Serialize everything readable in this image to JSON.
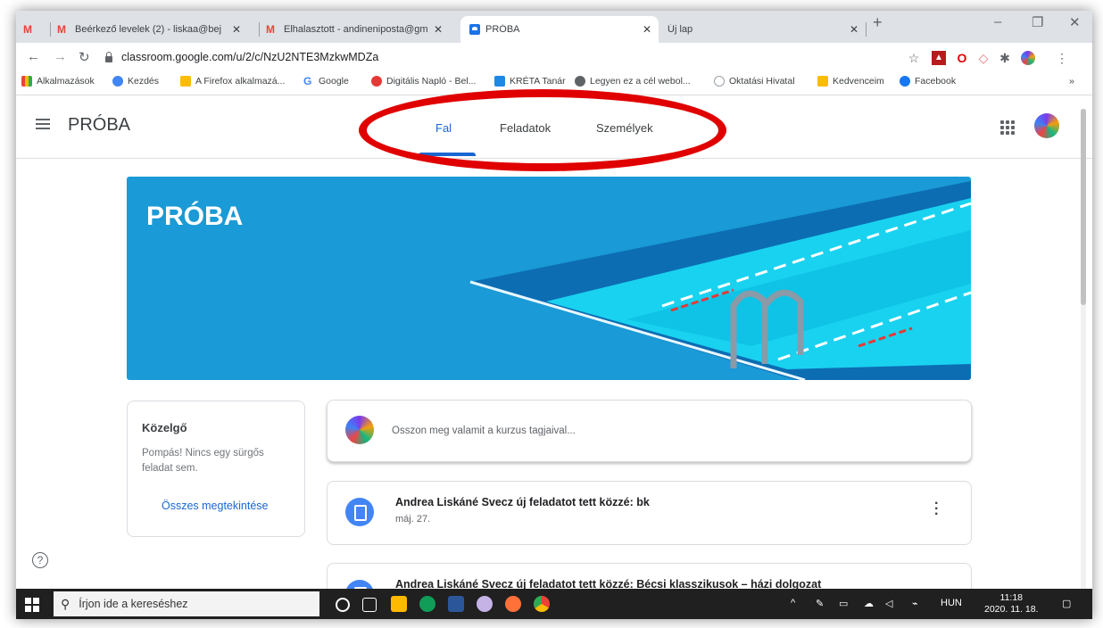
{
  "browser": {
    "tabs": [
      {
        "icon": "gmail-icon",
        "title": ""
      },
      {
        "icon": "gmail-icon",
        "title": "Beérkező levelek (2) - liskaa@bej"
      },
      {
        "icon": "gmail-icon",
        "title": "Elhalasztott - andineniposta@gm"
      },
      {
        "icon": "classroom-icon",
        "title": "PRÓBA"
      },
      {
        "icon": "",
        "title": "Új lap"
      }
    ],
    "tab_close": "✕",
    "new_tab": "+",
    "url": "classroom.google.com/u/2/c/NzU2NTE3MzkwMDZa",
    "bookmarks": [
      "Alkalmazások",
      "Kezdés",
      "A Firefox alkalmazá...",
      "Google",
      "Digitális Napló - Bel...",
      "KRÉTA Tanár",
      "Legyen ez a cél webol...",
      "Oktatási Hivatal",
      "Kedvenceim",
      "Facebook"
    ],
    "bookmarks_more": "»"
  },
  "classroom": {
    "title": "PRÓBA",
    "tabs": [
      "Fal",
      "Feladatok",
      "Személyek"
    ],
    "active_tab": "Fal",
    "banner_title": "PRÓBA",
    "upcoming": {
      "heading": "Közelgő",
      "body": "Pompás! Nincs egy sürgős feladat sem.",
      "link": "Összes megtekintése"
    },
    "share_placeholder": "Osszon meg valamit a kurzus tagjaival...",
    "posts": [
      {
        "title": "Andrea Liskáné Svecz új feladatot tett közzé: bk",
        "date": "máj. 27."
      },
      {
        "title": "Andrea Liskáné Svecz új feladatot tett közzé: Bécsi klasszikusok – házi dolgozat",
        "date": ""
      }
    ]
  },
  "taskbar": {
    "search_placeholder": "Írjon ide a kereséshez",
    "lang": "HUN",
    "time": "11:18",
    "date": "2020. 11. 18."
  },
  "colors": {
    "accent": "#1967d2",
    "banner": "#1a9ad6",
    "annotation": "#e00000"
  }
}
